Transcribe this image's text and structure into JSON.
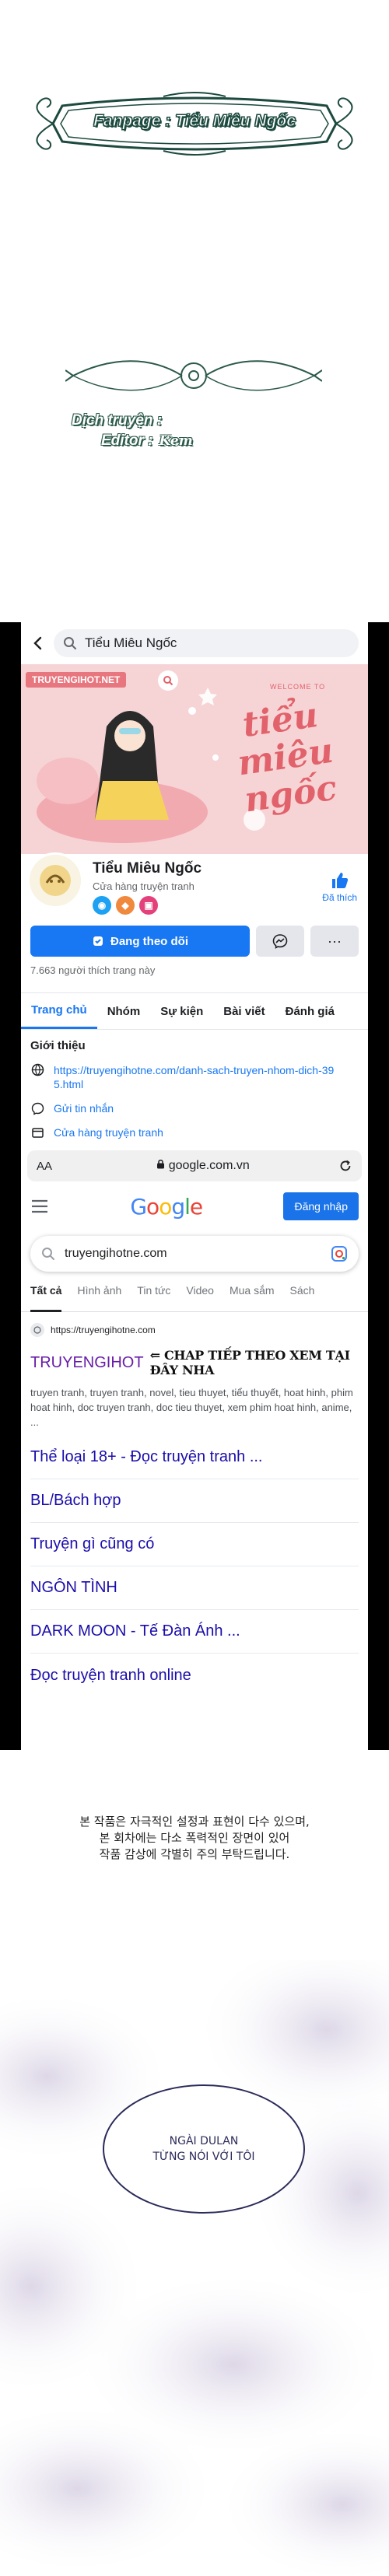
{
  "banner": {
    "text": "Fanpage : Tiểu Miêu Ngốc"
  },
  "credits": {
    "translator": "Dịch truyện :",
    "editor": "Editor :",
    "editor_signature": "Kem"
  },
  "facebook": {
    "search_text": "Tiểu Miêu Ngốc",
    "cover": {
      "site": "TRUYENGIHOT.NET",
      "welcome": "WELCOME TO",
      "title": "tiểu miêu ngốc"
    },
    "page_name": "Tiểu Miêu Ngốc",
    "category": "Cửa hàng truyện tranh",
    "like_label": "Đã thích",
    "follow_label": "Đang theo dõi",
    "more_label": "···",
    "likes_text": "7.663 người thích trang này",
    "tabs": [
      "Trang chủ",
      "Nhóm",
      "Sự kiện",
      "Bài viết",
      "Đánh giá"
    ],
    "intro": {
      "title": "Giới thiệu",
      "link": "https://truyengihotne.com/danh-sach-truyen-nhom-dich-395.html",
      "message": "Gửi tin nhắn",
      "shop": "Cửa hàng truyện tranh"
    },
    "colors": {
      "primary": "#1877f2",
      "cover_pink": "#e2626b"
    }
  },
  "browser": {
    "aa_label": "AA",
    "url": "google.com.vn"
  },
  "google": {
    "logo": [
      "G",
      "o",
      "o",
      "g",
      "l",
      "e"
    ],
    "signin_label": "Đăng nhập",
    "query": "truyengihotne.com",
    "tabs": [
      "Tất cả",
      "Hình ảnh",
      "Tin tức",
      "Video",
      "Mua sắm",
      "Sách"
    ],
    "result": {
      "url": "https://truyengihotne.com",
      "title": "TRUYENGIHOT",
      "overlay": "⇐ CHAP TIẾP THEO XEM TẠI ĐÂY NHA",
      "snippet": "truyen tranh, truyen tranh, novel, tieu thuyet, tiểu thuyết, hoat hinh, phim hoat hinh, doc truyen tranh, doc tieu thuyet, xem phim hoat hinh, anime, ..."
    },
    "sitelinks": [
      "Thể loại 18+ - Đọc truyện tranh ...",
      "BL/Bách hợp",
      "Truyện gì cũng có",
      "NGÔN TÌNH",
      "DARK MOON - Tế Đàn Ánh ...",
      "Đọc truyện tranh online"
    ]
  },
  "notice": {
    "line1": "본 작품은 자극적인 설정과 표현이 다수 있으며,",
    "line2": "본 회차에는 다소 폭력적인 장면이 있어",
    "line3": "작품 감상에 각별히 주의 부탁드립니다."
  },
  "speech": {
    "line1": "NGÀI DULAN",
    "line2": "TỪNG NÓI VỚI TÔI"
  }
}
